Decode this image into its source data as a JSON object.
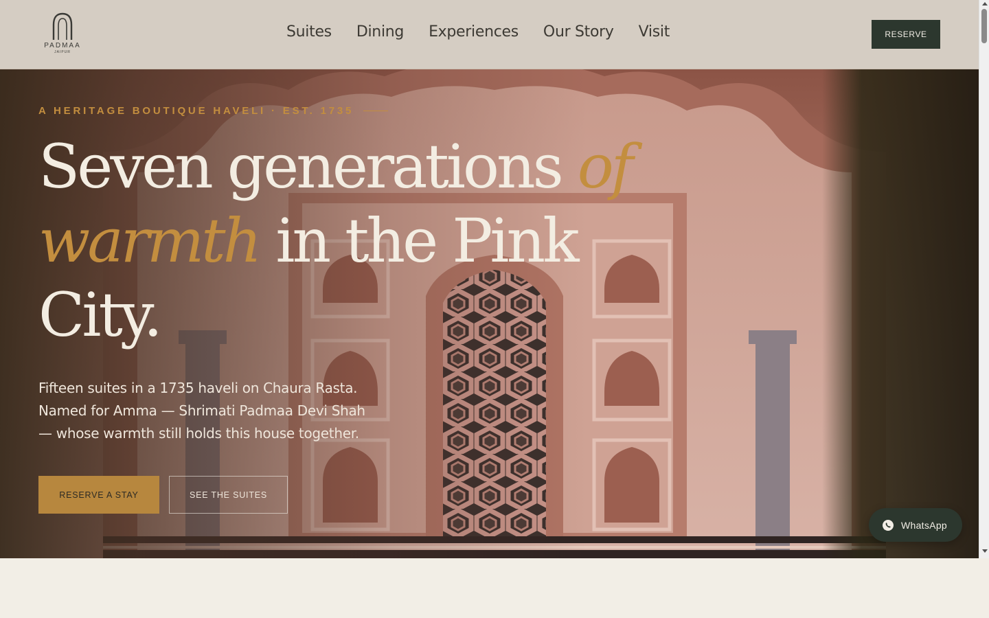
{
  "brand": {
    "name": "PADMAA",
    "location": "JAIPUR"
  },
  "nav": {
    "items": [
      {
        "label": "Suites"
      },
      {
        "label": "Dining"
      },
      {
        "label": "Experiences"
      },
      {
        "label": "Our Story"
      },
      {
        "label": "Visit"
      }
    ],
    "reserve_label": "RESERVE"
  },
  "hero": {
    "eyebrow": "A HERITAGE BOUTIQUE HAVELI · EST. 1735",
    "headline": {
      "part1": "Seven generations ",
      "accent1": "of",
      "accent2": "warmth",
      "part2": " in the Pink City."
    },
    "lede": "Fifteen suites in a 1735 haveli on Chaura Rasta. Named for Amma — Shrimati Padmaa Devi Shah — whose warmth still holds this house together.",
    "primary_cta": "RESERVE A STAY",
    "secondary_cta": "SEE THE SUITES"
  },
  "whatsapp": {
    "label": "WhatsApp"
  },
  "colors": {
    "header_bg": "#d5cdc3",
    "accent_gold": "#c38e3f",
    "dark_green": "#2c372e",
    "cream": "#f2eee6"
  }
}
